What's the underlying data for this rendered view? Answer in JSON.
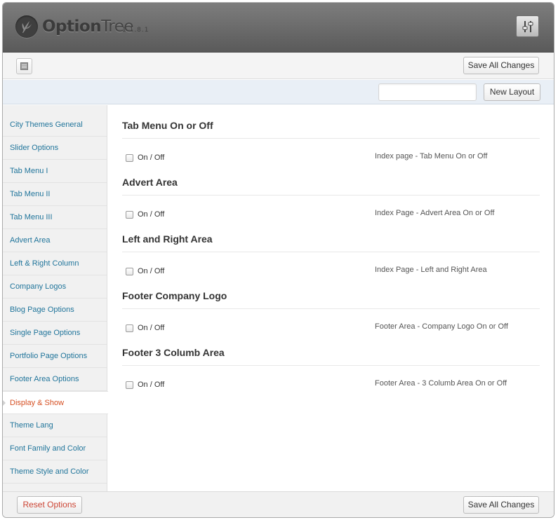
{
  "header": {
    "brand_bold": "Option",
    "brand_thin": "Tree",
    "version": "1.1.8.1",
    "icons": {
      "logo": "leaf-icon",
      "settings": "sliders-icon",
      "docs": "document-icon"
    }
  },
  "toolbar": {
    "save_label": "Save All Changes"
  },
  "layout_bar": {
    "input_value": "",
    "input_placeholder": "",
    "new_layout_label": "New Layout"
  },
  "sidebar": {
    "items": [
      {
        "label": "City Themes General",
        "active": false
      },
      {
        "label": "Slider Options",
        "active": false
      },
      {
        "label": "Tab Menu I",
        "active": false
      },
      {
        "label": "Tab Menu II",
        "active": false
      },
      {
        "label": "Tab Menu III",
        "active": false
      },
      {
        "label": "Advert Area",
        "active": false
      },
      {
        "label": "Left & Right Column",
        "active": false
      },
      {
        "label": "Company Logos",
        "active": false
      },
      {
        "label": "Blog Page Options",
        "active": false
      },
      {
        "label": "Single Page Options",
        "active": false
      },
      {
        "label": "Portfolio Page Options",
        "active": false
      },
      {
        "label": "Footer Area Options",
        "active": false
      },
      {
        "label": "Display & Show",
        "active": true
      },
      {
        "label": "Theme Lang",
        "active": false
      },
      {
        "label": "Font Family and Color",
        "active": false
      },
      {
        "label": "Theme Style and Color",
        "active": false
      }
    ]
  },
  "main": {
    "sections": [
      {
        "title": "Tab Menu On or Off",
        "checkbox_label": "On / Off",
        "checked": false,
        "description": "Index page - Tab Menu On or Off"
      },
      {
        "title": "Advert Area",
        "checkbox_label": "On / Off",
        "checked": false,
        "description": "Index Page - Advert Area On or Off"
      },
      {
        "title": "Left and Right Area",
        "checkbox_label": "On / Off",
        "checked": false,
        "description": "Index Page - Left and Right Area"
      },
      {
        "title": "Footer Company Logo",
        "checkbox_label": "On / Off",
        "checked": false,
        "description": "Footer Area - Company Logo On or Off"
      },
      {
        "title": "Footer 3 Columb Area",
        "checkbox_label": "On / Off",
        "checked": false,
        "description": "Footer Area - 3 Columb Area On or Off"
      }
    ]
  },
  "footer": {
    "reset_label": "Reset Options",
    "save_label": "Save All Changes"
  },
  "colors": {
    "link": "#21759b",
    "active_link": "#d54e21",
    "header_bg": "#6b6b6b",
    "layout_bar_bg": "#e9eff6"
  }
}
